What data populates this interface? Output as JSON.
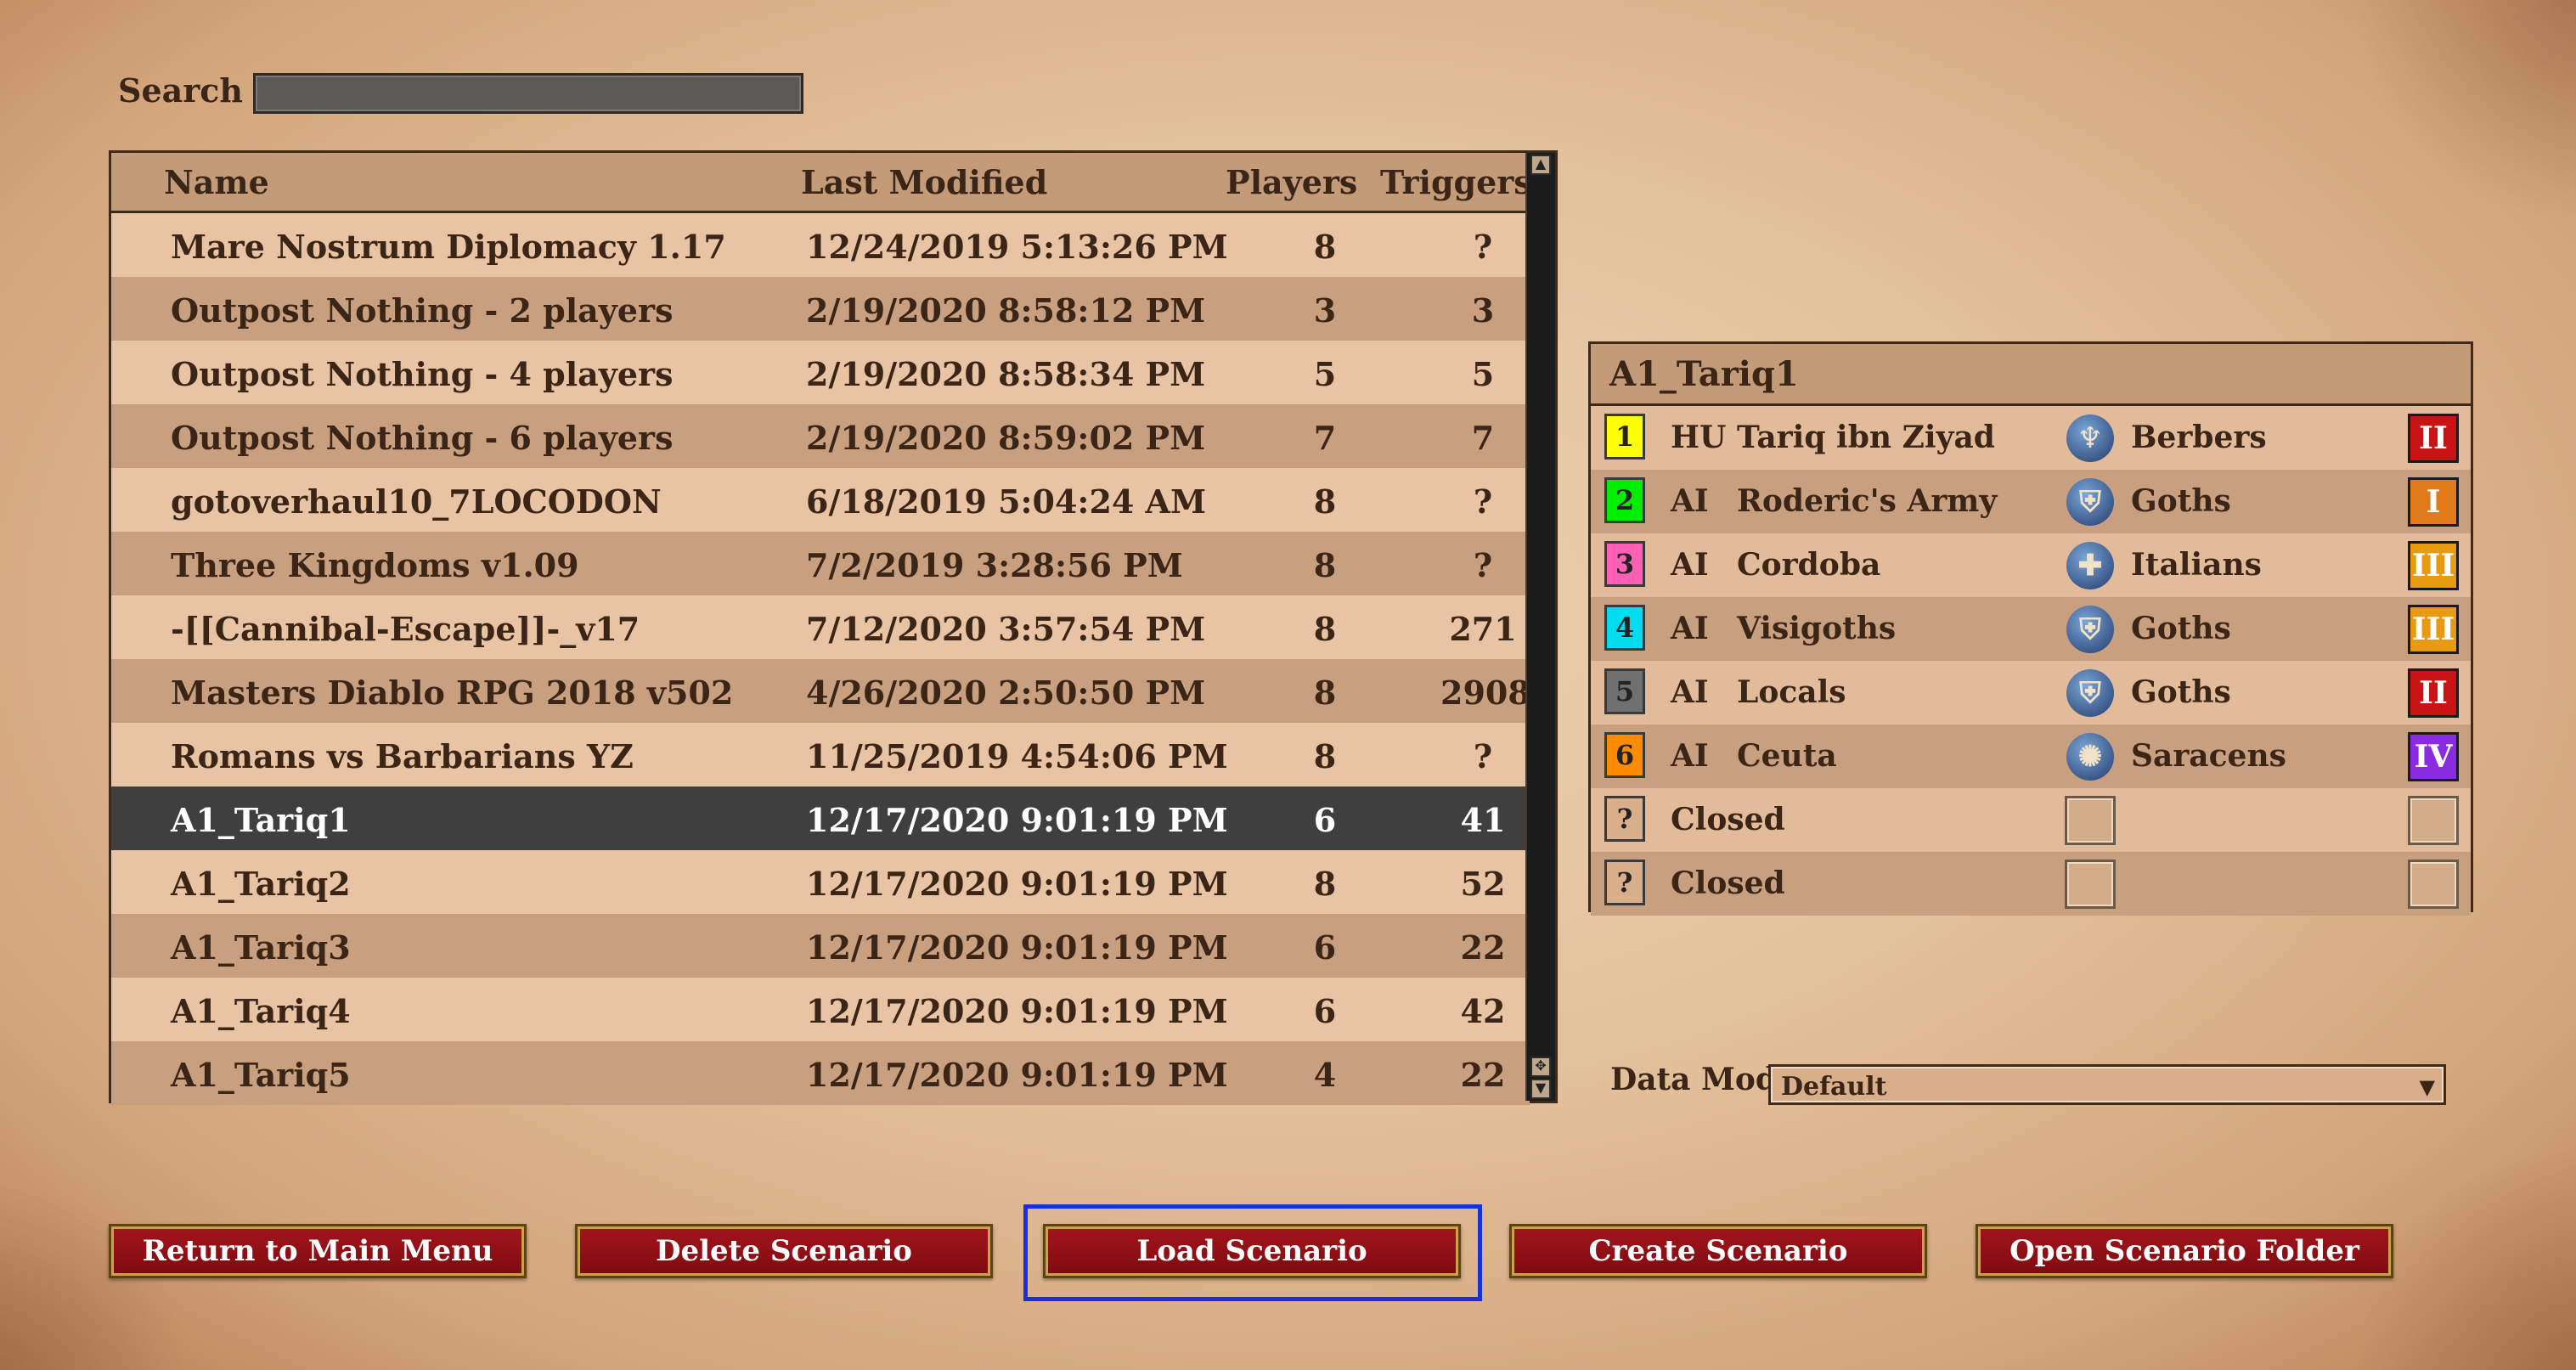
{
  "search": {
    "label": "Search",
    "value": ""
  },
  "list": {
    "headers": {
      "name": "Name",
      "modified": "Last Modified",
      "players": "Players",
      "triggers": "Triggers"
    },
    "rows": [
      {
        "name": "Mare Nostrum Diplomacy 1.17",
        "modified": "12/24/2019 5:13:26 PM",
        "players": "8",
        "triggers": "?"
      },
      {
        "name": "Outpost Nothing - 2 players",
        "modified": "2/19/2020 8:58:12 PM",
        "players": "3",
        "triggers": "3"
      },
      {
        "name": "Outpost Nothing - 4 players",
        "modified": "2/19/2020 8:58:34 PM",
        "players": "5",
        "triggers": "5"
      },
      {
        "name": "Outpost Nothing - 6 players",
        "modified": "2/19/2020 8:59:02 PM",
        "players": "7",
        "triggers": "7"
      },
      {
        "name": "gotoverhaul10_7LOCODON",
        "modified": "6/18/2019 5:04:24 AM",
        "players": "8",
        "triggers": "?"
      },
      {
        "name": "Three Kingdoms v1.09",
        "modified": "7/2/2019 3:28:56 PM",
        "players": "8",
        "triggers": "?"
      },
      {
        "name": "-[[Cannibal-Escape]]-_v17",
        "modified": "7/12/2020 3:57:54 PM",
        "players": "8",
        "triggers": "271"
      },
      {
        "name": "Masters Diablo RPG 2018 v502",
        "modified": "4/26/2020 2:50:50 PM",
        "players": "8",
        "triggers": "2908"
      },
      {
        "name": "Romans vs Barbarians YZ",
        "modified": "11/25/2019 4:54:06 PM",
        "players": "8",
        "triggers": "?"
      },
      {
        "name": "A1_Tariq1",
        "modified": "12/17/2020 9:01:19 PM",
        "players": "6",
        "triggers": "41"
      },
      {
        "name": "A1_Tariq2",
        "modified": "12/17/2020 9:01:19 PM",
        "players": "8",
        "triggers": "52"
      },
      {
        "name": "A1_Tariq3",
        "modified": "12/17/2020 9:01:19 PM",
        "players": "6",
        "triggers": "22"
      },
      {
        "name": "A1_Tariq4",
        "modified": "12/17/2020 9:01:19 PM",
        "players": "6",
        "triggers": "42"
      },
      {
        "name": "A1_Tariq5",
        "modified": "12/17/2020 9:01:19 PM",
        "players": "4",
        "triggers": "22"
      }
    ],
    "selected_index": 9
  },
  "players_panel": {
    "title": "A1_Tariq1",
    "players": [
      {
        "num": "1",
        "color": "#ffff00",
        "type": "HU",
        "name": "Tariq ibn Ziyad",
        "civ": "Berbers",
        "civ_icon": "berbers-shield-icon",
        "age": "II",
        "age_color": "#c81414"
      },
      {
        "num": "2",
        "color": "#00ee00",
        "type": "AI",
        "name": "Roderic's Army",
        "civ": "Goths",
        "civ_icon": "goths-emblem-icon",
        "age": "I",
        "age_color": "#e07a1a"
      },
      {
        "num": "3",
        "color": "#ff5fb4",
        "type": "AI",
        "name": "Cordoba",
        "civ": "Italians",
        "civ_icon": "italians-cross-shield-icon",
        "age": "III",
        "age_color": "#e89a10"
      },
      {
        "num": "4",
        "color": "#00dcf0",
        "type": "AI",
        "name": "Visigoths",
        "civ": "Goths",
        "civ_icon": "goths-emblem-icon",
        "age": "III",
        "age_color": "#e89a10"
      },
      {
        "num": "5",
        "color": "#707070",
        "type": "AI",
        "name": "Locals",
        "civ": "Goths",
        "civ_icon": "goths-emblem-icon",
        "age": "II",
        "age_color": "#c81414"
      },
      {
        "num": "6",
        "color": "#ff8c00",
        "type": "AI",
        "name": "Ceuta",
        "civ": "Saracens",
        "civ_icon": "saracens-emblem-icon",
        "age": "IV",
        "age_color": "#8a2be2"
      },
      {
        "num": "?",
        "color": "#d8ae8b",
        "type": "",
        "name": "Closed",
        "civ": "",
        "civ_icon": "",
        "age": "",
        "age_color": ""
      },
      {
        "num": "?",
        "color": "#d8ae8b",
        "type": "",
        "name": "Closed",
        "civ": "",
        "civ_icon": "",
        "age": "",
        "age_color": ""
      }
    ]
  },
  "data_mod": {
    "label": "Data Mod",
    "value": "Default"
  },
  "buttons": {
    "return": "Return to Main Menu",
    "delete": "Delete Scenario",
    "load": "Load Scenario",
    "create": "Create Scenario",
    "open_folder": "Open Scenario Folder"
  }
}
